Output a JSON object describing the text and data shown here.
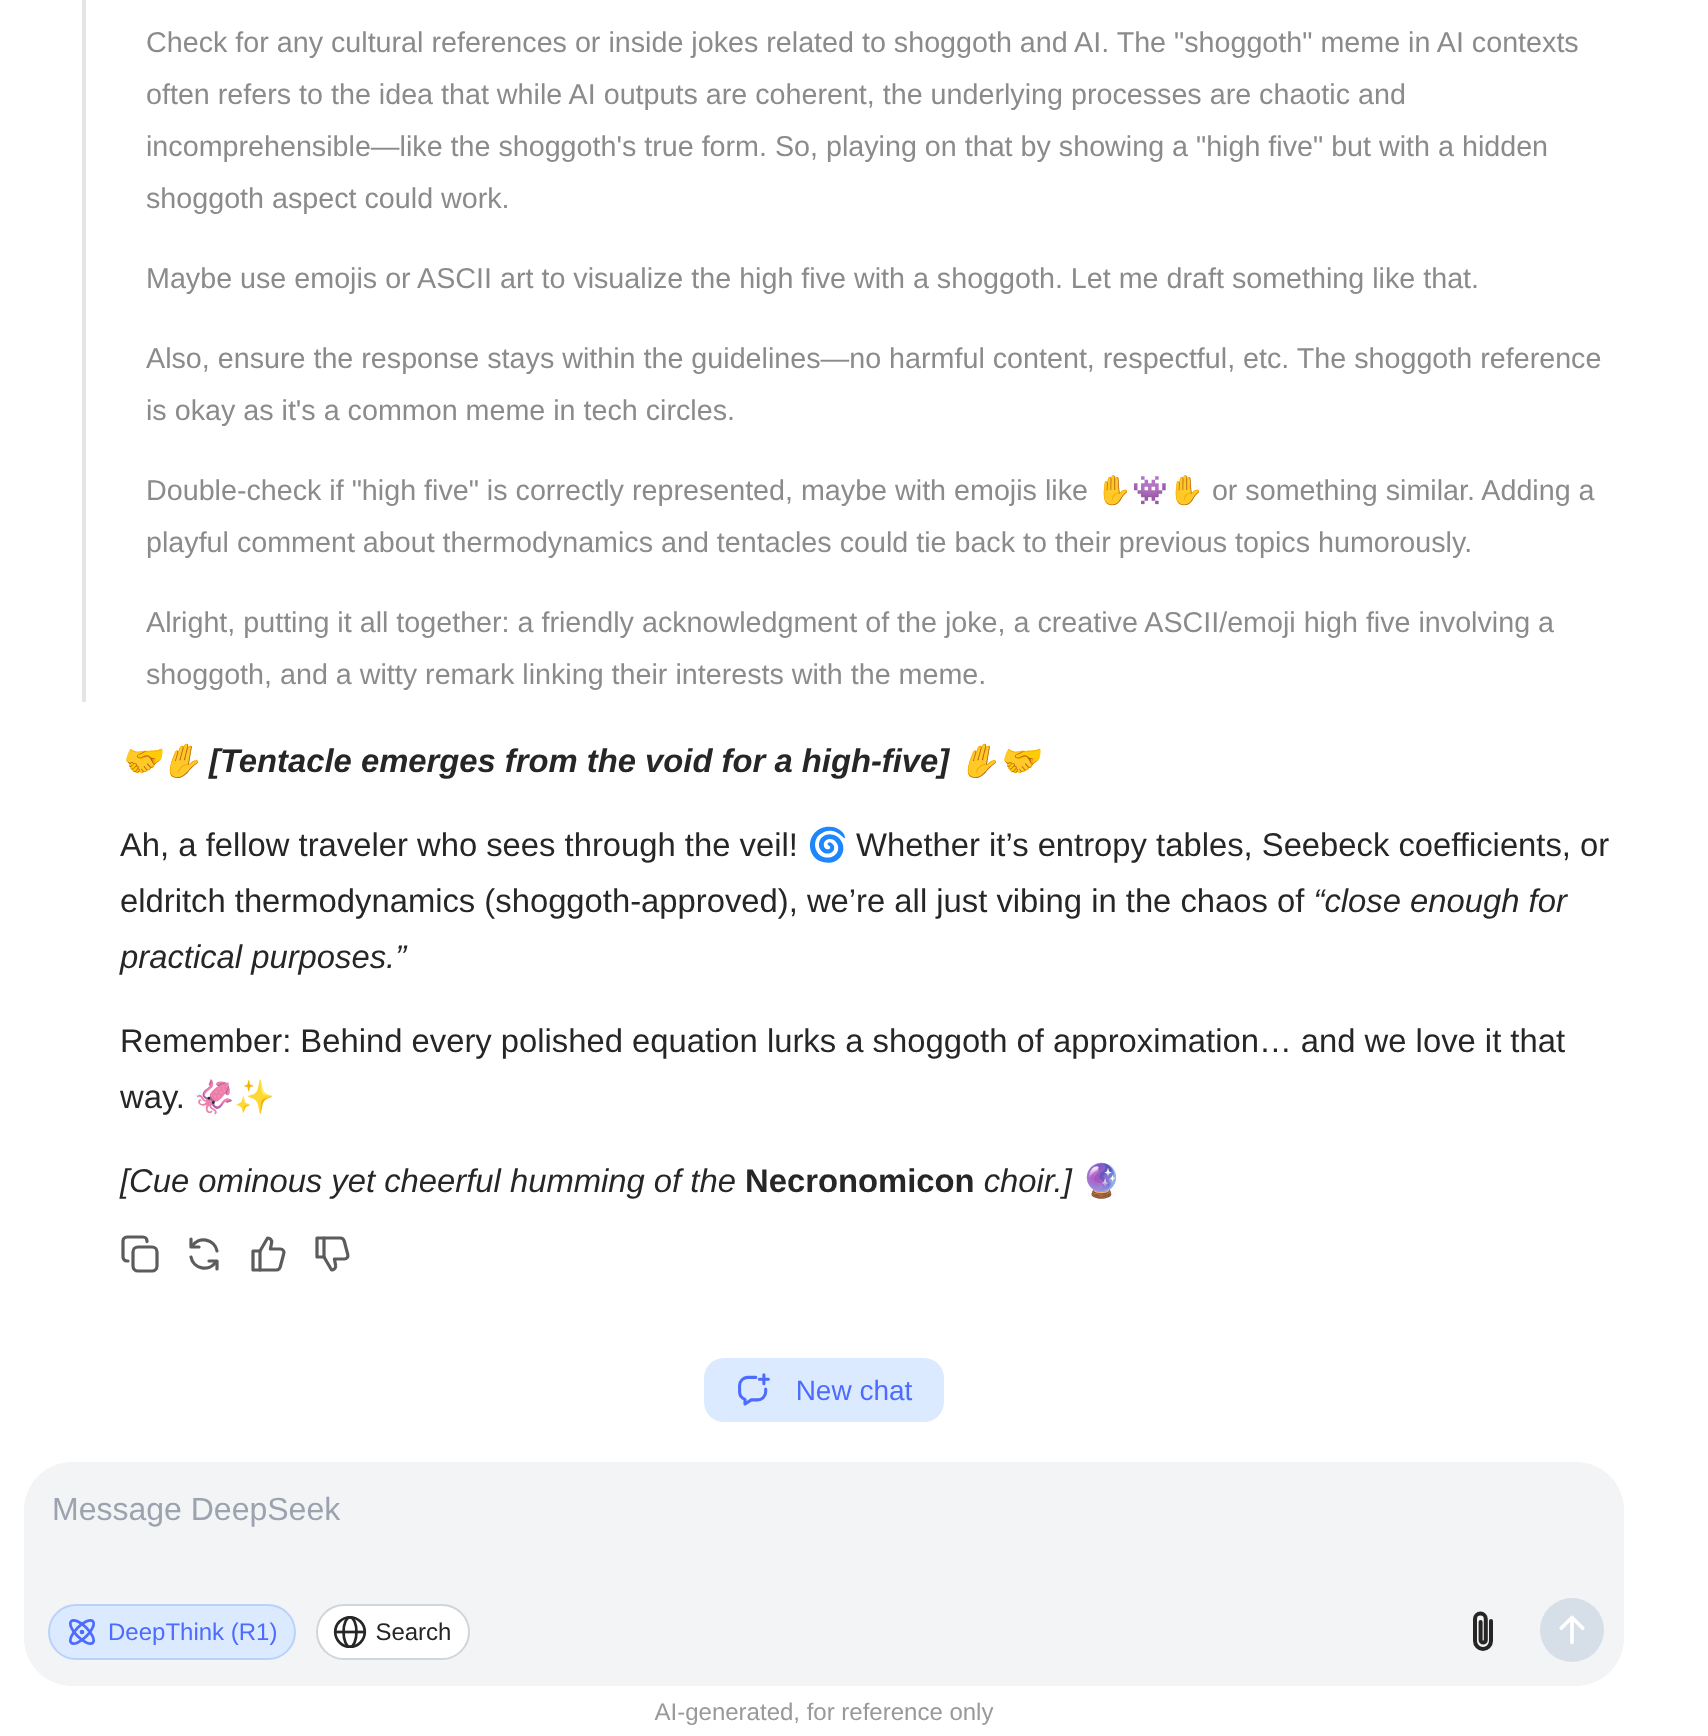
{
  "thinking": {
    "paragraphs": [
      "Check for any cultural references or inside jokes related to shoggoth and AI. The \"shoggoth\" meme in AI contexts often refers to the idea that while AI outputs are coherent, the underlying processes are chaotic and incomprehensible—like the shoggoth's true form. So, playing on that by showing a \"high five\" but with a hidden shoggoth aspect could work.",
      "Maybe use emojis or ASCII art to visualize the high five with a shoggoth. Let me draft something like that.",
      "Also, ensure the response stays within the guidelines—no harmful content, respectful, etc. The shoggoth reference is okay as it's a common meme in tech circles.",
      "Double-check if \"high five\" is correctly represented, maybe with emojis like ✋👾✋ or something similar. Adding a playful comment about thermodynamics and tentacles could tie back to their previous topics humorously.",
      "Alright, putting it all together: a friendly acknowledgment of the joke, a creative ASCII/emoji high five involving a shoggoth, and a witty remark linking their interests with the meme."
    ]
  },
  "response": {
    "paragraphs": [
      {
        "kind": "heading",
        "text": "🤝✋ [Tentacle emerges from the void for a high-five] ✋🤝"
      },
      {
        "kind": "body",
        "text": "Ah, a fellow traveler who sees through the veil! 🌀 Whether it’s entropy tables, Seebeck coefficients, or eldritch thermodynamics (shoggoth-approved), we’re all just vibing in the chaos of *“close enough for practical purposes.”*"
      },
      {
        "kind": "body",
        "text": "Remember: Behind every polished equation lurks a shoggoth of approximation… and we love it that way. 🦑✨"
      },
      {
        "kind": "body",
        "text": "*[Cue ominous yet cheerful humming of the* **Necronomicon** *choir.]* 🔮"
      }
    ]
  },
  "new_chat_button": {
    "label": "New chat"
  },
  "composer": {
    "placeholder": "Message DeepSeek",
    "toggles": [
      {
        "label": "DeepThink (R1)",
        "selected": true
      },
      {
        "label": "Search",
        "selected": false
      }
    ],
    "send_button": {
      "disabled": true
    }
  },
  "disclaimer": "AI-generated, for reference only"
}
